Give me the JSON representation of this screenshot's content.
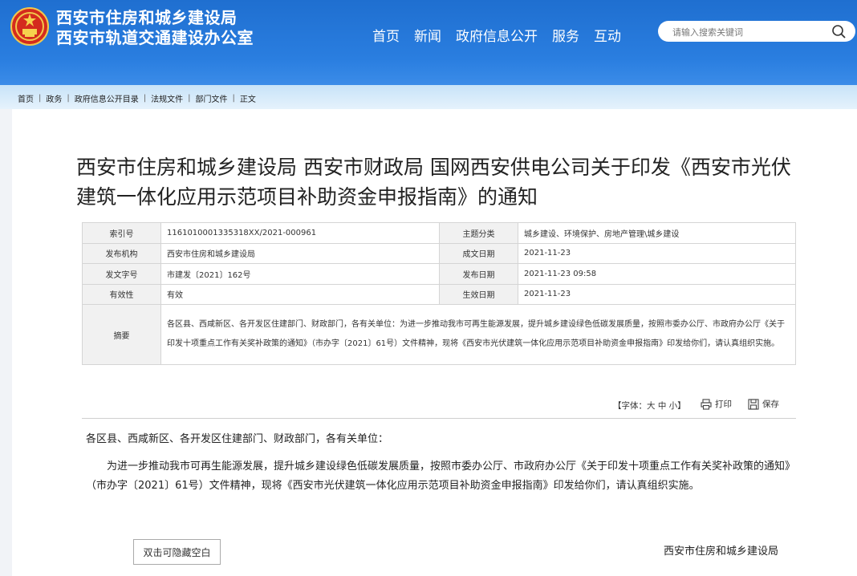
{
  "header": {
    "line1": "西安市住房和城乡建设局",
    "line2": "西安市轨道交通建设办公室",
    "nav": [
      "首页",
      "新闻",
      "政府信息公开",
      "服务",
      "互动"
    ],
    "search_placeholder": "请输入搜索关键词"
  },
  "breadcrumb": [
    "首页",
    "政务",
    "政府信息公开目录",
    "法规文件",
    "部门文件",
    "正文"
  ],
  "article": {
    "title": "西安市住房和城乡建设局 西安市财政局 国网西安供电公司关于印发《西安市光伏建筑一体化应用示范项目补助资金申报指南》的通知",
    "meta": {
      "index_label": "索引号",
      "index_value": "1161010001335318XX/2021-000961",
      "topic_label": "主题分类",
      "topic_value": "城乡建设、环境保护、房地产管理\\城乡建设",
      "issuer_label": "发布机构",
      "issuer_value": "西安市住房和城乡建设局",
      "written_label": "成文日期",
      "written_value": "2021-11-23",
      "docno_label": "发文字号",
      "docno_value": "市建发〔2021〕162号",
      "published_label": "发布日期",
      "published_value": "2021-11-23 09:58",
      "validity_label": "有效性",
      "validity_value": "有效",
      "effective_label": "生效日期",
      "effective_value": "2021-11-23",
      "abstract_label": "摘要",
      "abstract_value": "各区县、西咸新区、各开发区住建部门、财政部门，各有关单位：为进一步推动我市可再生能源发展，提升城乡建设绿色低碳发展质量，按照市委办公厅、市政府办公厅《关于印发十项重点工作有关奖补政策的通知》（市办字〔2021〕61号）文件精神，现将《西安市光伏建筑一体化应用示范项目补助资金申报指南》印发给你们，请认真组织实施。"
    },
    "tools": {
      "font_size": "【字体：大 中 小】",
      "print": "打印",
      "save": "保存"
    },
    "salutation": "各区县、西咸新区、各开发区住建部门、财政部门，各有关单位：",
    "paragraph": "为进一步推动我市可再生能源发展，提升城乡建设绿色低碳发展质量，按照市委办公厅、市政府办公厅《关于印发十项重点工作有关奖补政策的通知》（市办字〔2021〕61号）文件精神，现将《西安市光伏建筑一体化应用示范项目补助资金申报指南》印发给你们，请认真组织实施。",
    "hide_button": "双击可隐藏空白",
    "signature": "西安市住房和城乡建设局"
  },
  "colors": {
    "header_blue": "#2a7ee0",
    "crumb_bg": "#d6ebfa"
  }
}
